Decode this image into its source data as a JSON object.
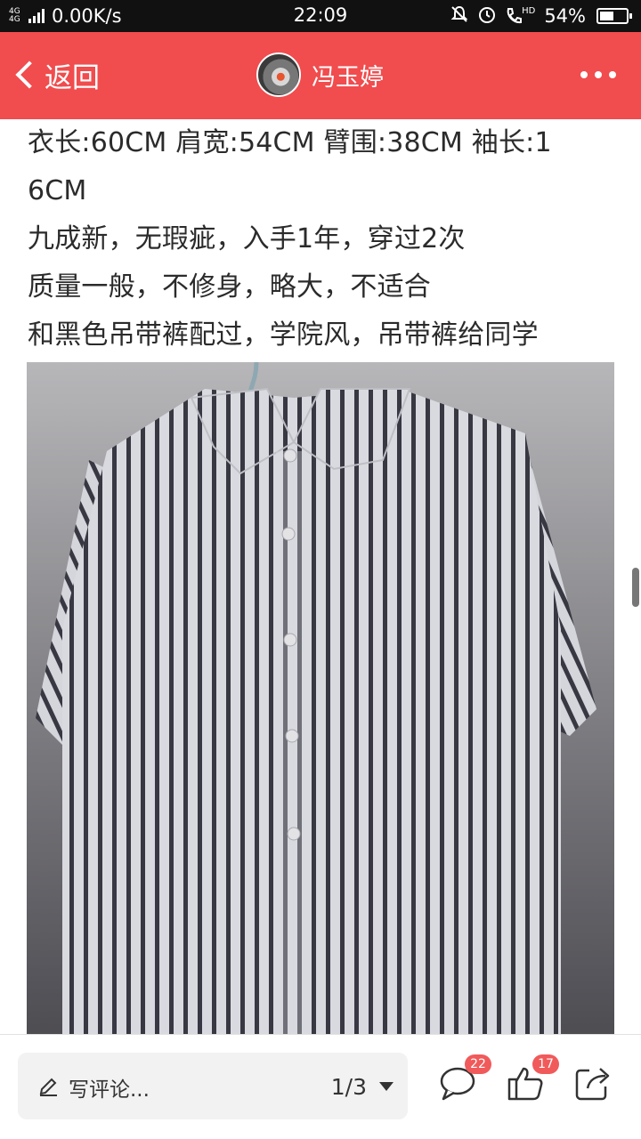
{
  "status_bar": {
    "network": "4G 4G",
    "speed": "0.00K/s",
    "time": "22:09",
    "hd": "HD",
    "battery_text": "54%",
    "battery_level": 0.54,
    "icons": [
      "signal-icon",
      "mute-icon",
      "alarm-icon",
      "call-hd-icon",
      "battery-icon"
    ]
  },
  "header": {
    "back_label": "返回",
    "username": "冯玉婷",
    "background_color": "#f14c4e"
  },
  "description": {
    "lines": [
      "衣长:60CM  肩宽:54CM  臂围:38CM  袖长:1",
      "6CM",
      "九成新，无瑕疵，入手1年，穿过2次",
      "质量一般，不修身，略大，不适合",
      "和黑色吊带裤配过，学院风，吊带裤给同学"
    ]
  },
  "photo": {
    "subject": "striped-shirt-photo"
  },
  "bottom_bar": {
    "comment_placeholder": "写评论...",
    "page_indicator": "1/3",
    "comment_count": "22",
    "like_count": "17"
  }
}
